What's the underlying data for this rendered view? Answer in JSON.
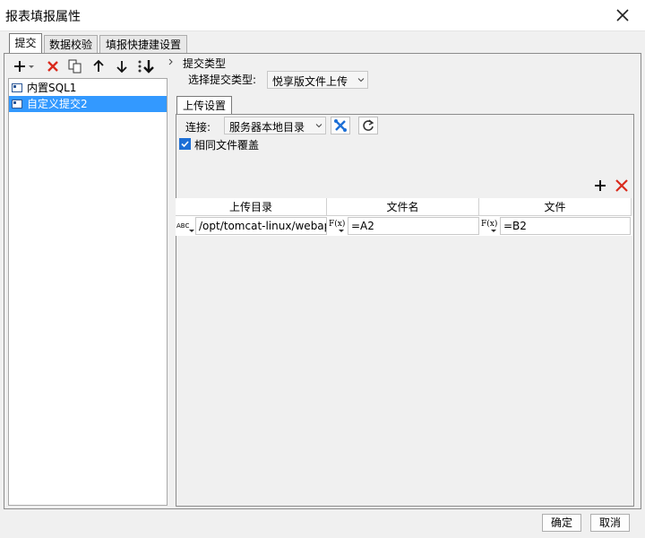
{
  "window": {
    "title": "报表填报属性"
  },
  "tabs": [
    {
      "label": "提交",
      "active": true
    },
    {
      "label": "数据校验",
      "active": false
    },
    {
      "label": "填报快捷建设置",
      "active": false
    }
  ],
  "tree": {
    "items": [
      {
        "label": "内置SQL1",
        "selected": false
      },
      {
        "label": "自定义提交2",
        "selected": true
      }
    ]
  },
  "submit_type": {
    "group_title": "提交类型",
    "label": "选择提交类型:",
    "value": "悦享版文件上传"
  },
  "upload": {
    "tab_label": "上传设置",
    "connection_label": "连接:",
    "connection_value": "服务器本地目录",
    "overwrite_label": "相同文件覆盖",
    "overwrite_checked": true
  },
  "table": {
    "headers": [
      "上传目录",
      "文件名",
      "文件"
    ],
    "rows": [
      {
        "dir": "/opt/tomcat-linux/webapps",
        "dir_icon_text": "ABC",
        "filename": "=A2",
        "filename_icon_text": "F(x)",
        "file": "=B2",
        "file_icon_text": "F(x)"
      }
    ]
  },
  "buttons": {
    "ok": "确定",
    "cancel": "取消"
  },
  "colors": {
    "accent": "#3399ff",
    "delete": "#d92a1c",
    "icon_blue": "#1d6fd6"
  }
}
